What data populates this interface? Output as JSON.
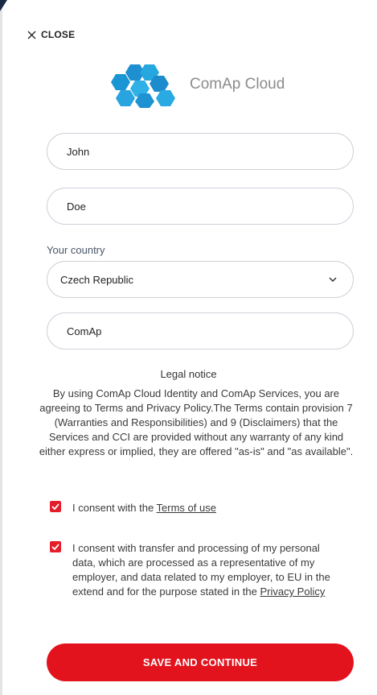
{
  "close_label": "CLOSE",
  "logo": {
    "brand": "ComAp Cloud"
  },
  "form": {
    "first_name": "John",
    "last_name": "Doe",
    "country_label": "Your country",
    "country_value": "Czech Republic",
    "company": "ComAp"
  },
  "legal": {
    "title": "Legal notice",
    "text": "By using ComAp Cloud Identity and ComAp Services, you are agreeing to Terms and Privacy Policy.The Terms contain provision 7 (Warranties and Responsibilities) and 9 (Disclaimers) that the Services and CCI are provided without any warranty of any kind either express or implied, they are offered \"as-is\" and \"as available\"."
  },
  "consents": [
    {
      "text": "I consent with the ",
      "link": "Terms of use",
      "checked": true
    },
    {
      "text": "I consent with transfer and processing of my personal data, which are processed as a representative of my employer, and data related to my employer, to EU in the extend and for the purpose stated in the ",
      "link": "Privacy Policy",
      "checked": true
    }
  ],
  "save_label": "SAVE AND CONTINUE",
  "colors": {
    "accent": "#e3131e",
    "logo_blue": "#1a9ad6"
  }
}
